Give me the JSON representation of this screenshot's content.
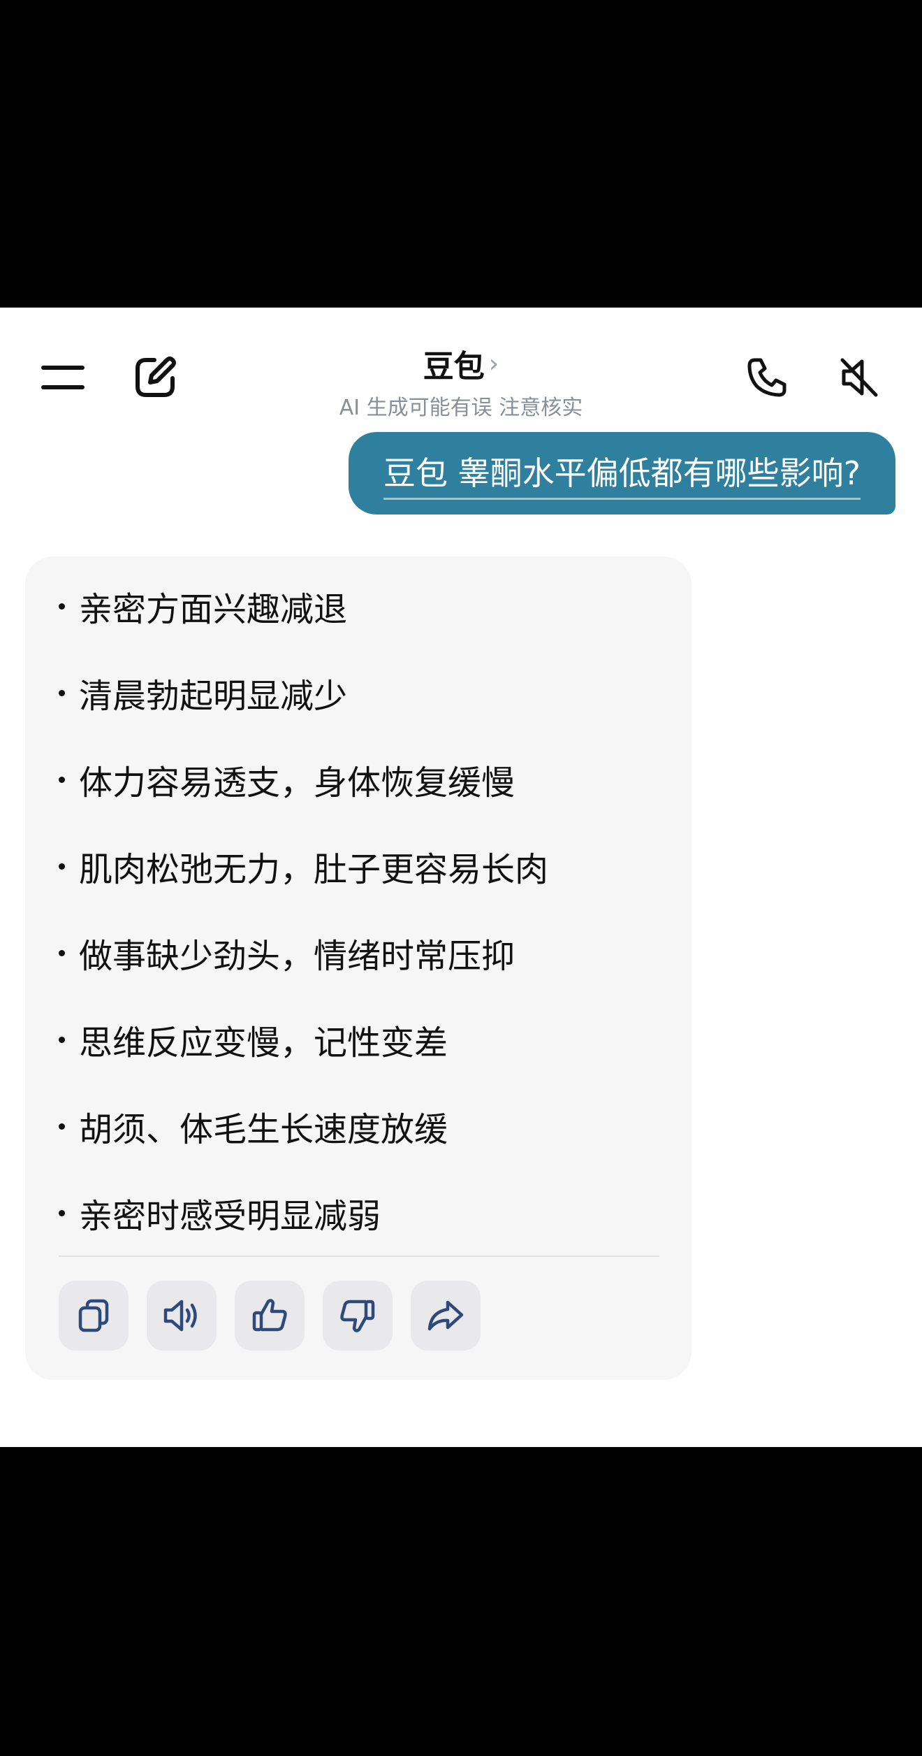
{
  "header": {
    "title": "豆包",
    "title_chevron": "›",
    "subtitle": "AI 生成可能有误 注意核实"
  },
  "user_message": "豆包 睾酮水平偏低都有哪些影响?",
  "answer": {
    "items": [
      "亲密方面兴趣减退",
      "清晨勃起明显减少",
      "体力容易透支，身体恢复缓慢",
      "肌肉松弛无力，肚子更容易长肉",
      "做事缺少劲头，情绪时常压抑",
      "思维反应变慢，记性变差",
      "胡须、体毛生长速度放缓",
      "亲密时感受明显减弱"
    ]
  },
  "actions": [
    "copy-icon",
    "speaker-icon",
    "thumbs-up-icon",
    "thumbs-down-icon",
    "share-icon"
  ],
  "colors": {
    "user_bubble": "#2f7f9e",
    "card_bg": "#f6f6f7",
    "action_icon": "#2d4a7a"
  }
}
